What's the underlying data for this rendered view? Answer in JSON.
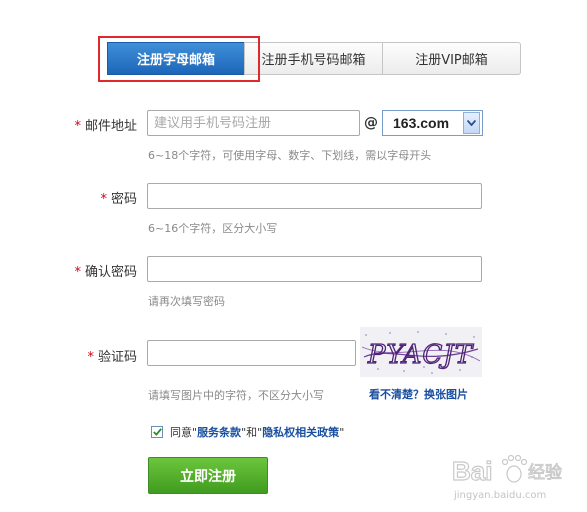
{
  "tabs": [
    {
      "label": "注册字母邮箱",
      "active": true
    },
    {
      "label": "注册手机号码邮箱",
      "active": false
    },
    {
      "label": "注册VIP邮箱",
      "active": false
    }
  ],
  "form": {
    "required_mark": "*",
    "email": {
      "label": "邮件地址",
      "placeholder": "建议用手机号码注册",
      "at_symbol": "@",
      "domain": "163.com",
      "hint": "6~18个字符，可使用字母、数字、下划线，需以字母开头"
    },
    "password": {
      "label": "密码",
      "hint": "6~16个字符，区分大小写"
    },
    "confirm": {
      "label": "确认密码",
      "hint": "请再次填写密码"
    },
    "captcha": {
      "label": "验证码",
      "hint": "请填写图片中的字符，不区分大小写",
      "image_text": "PYACJT",
      "refresh_text": "看不清楚？换张图片"
    },
    "agree": {
      "prefix": "同意\"",
      "terms": "服务条款",
      "middle": "\"和\"",
      "privacy": "隐私权相关政策",
      "suffix": "\"",
      "checked": true
    },
    "submit_label": "立即注册"
  },
  "watermark": {
    "brand": "Bai",
    "brand_suffix": "经验",
    "url": "jingyan.baidu.com"
  },
  "colors": {
    "tab_active": "#1d66b8",
    "highlight": "#e0282f",
    "required": "#d0021b",
    "link": "#1a4fa0",
    "submit": "#409c1f"
  }
}
